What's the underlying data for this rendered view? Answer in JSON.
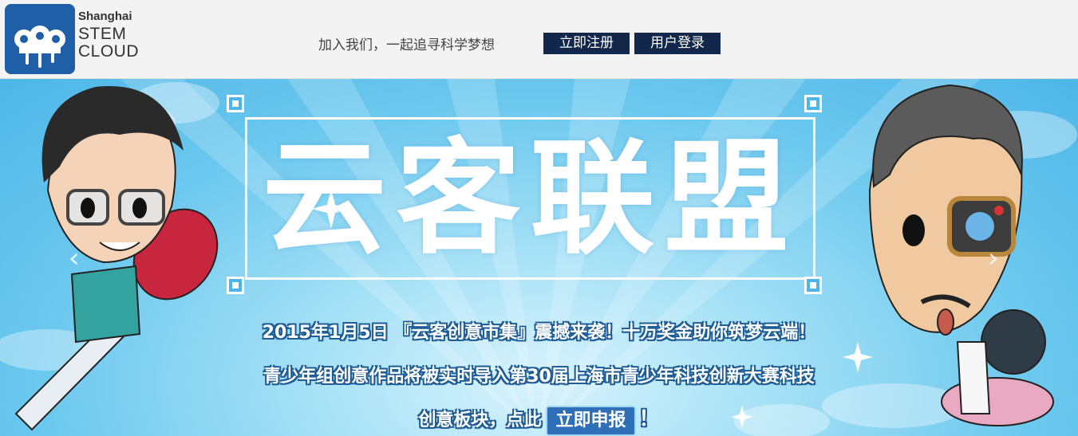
{
  "header": {
    "brand_small": "Shanghai",
    "brand_line1": "STEM",
    "brand_line2": "CLOUD",
    "slogan": "加入我们，一起追寻科学梦想",
    "register_label": "立即注册",
    "login_label": "用户登录"
  },
  "banner": {
    "title": "云客联盟",
    "line1": "2015年1月5日 『云客创意市集』震撼来袭！十万奖金助你筑梦云端！",
    "line2": "青少年组创意作品将被实时导入第30届上海市青少年科技创新大赛科技",
    "line3_prefix": "创意板块，点此",
    "report_button": "立即申报",
    "line3_suffix": "！",
    "prev_arrow": "‹",
    "next_arrow": "›"
  },
  "colors": {
    "nav_button_bg": "#12274a",
    "logo_bg": "#1e5fa8",
    "banner_sky": "#6cc8ee"
  },
  "icons": [
    "stem-cloud-logo-icon",
    "chevron-left-icon",
    "chevron-right-icon",
    "sparkle-icon"
  ]
}
